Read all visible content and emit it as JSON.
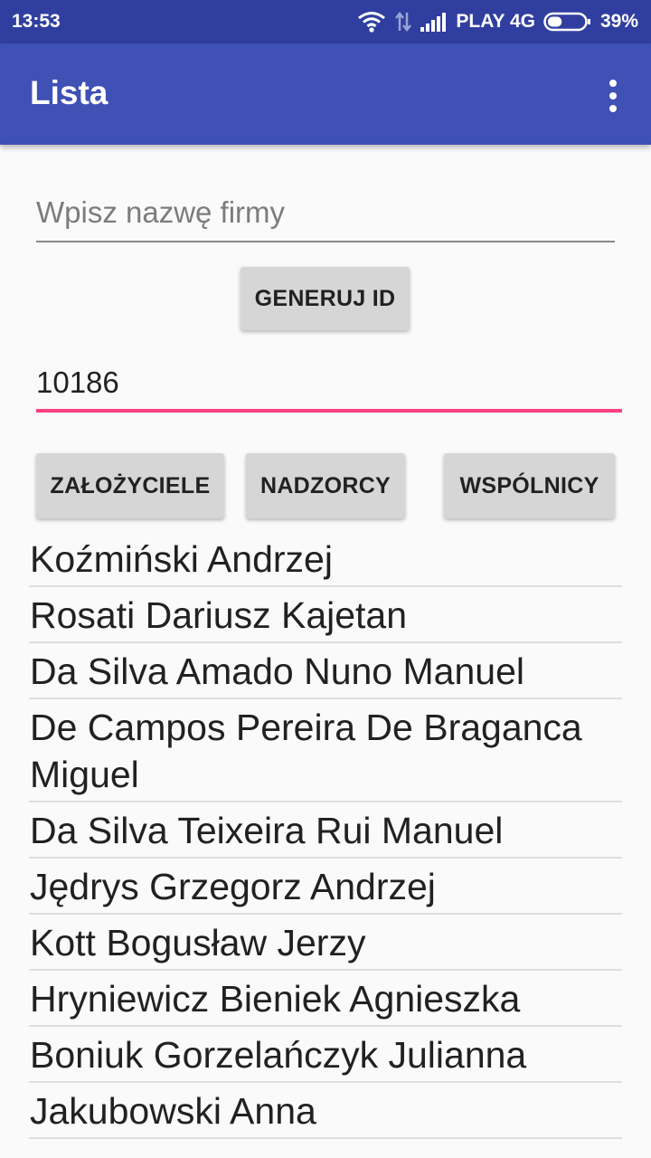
{
  "status_bar": {
    "time": "13:53",
    "carrier": "PLAY 4G",
    "battery": "39%",
    "battery_level": 0.39,
    "icons": [
      "wifi-icon",
      "data-arrows-icon",
      "signal-icon",
      "battery-icon"
    ]
  },
  "app_bar": {
    "title": "Lista",
    "menu_icon": "more-vert-icon"
  },
  "form": {
    "company_name": {
      "value": "",
      "placeholder": "Wpisz nazwę firmy"
    },
    "generate_button": "GENERUJ ID",
    "id_field": {
      "value": "10186"
    }
  },
  "category_buttons": [
    "ZAŁOŻYCIELE",
    "NADZORCY",
    "WSPÓLNICY"
  ],
  "people": [
    "Koźmiński Andrzej",
    "Rosati Dariusz Kajetan",
    "Da Silva Amado Nuno Manuel",
    "De Campos Pereira De Braganca Miguel",
    "Da Silva Teixeira Rui Manuel",
    "Jędrys Grzegorz Andrzej",
    "Kott Bogusław Jerzy",
    "Hryniewicz Bieniek Agnieszka",
    "Boniuk Gorzelańczyk Julianna",
    "Jakubowski Anna"
  ],
  "colors": {
    "status_bar": "#303f9f",
    "app_bar": "#3f51b5",
    "accent": "#ff4081",
    "button": "#d6d6d6"
  }
}
